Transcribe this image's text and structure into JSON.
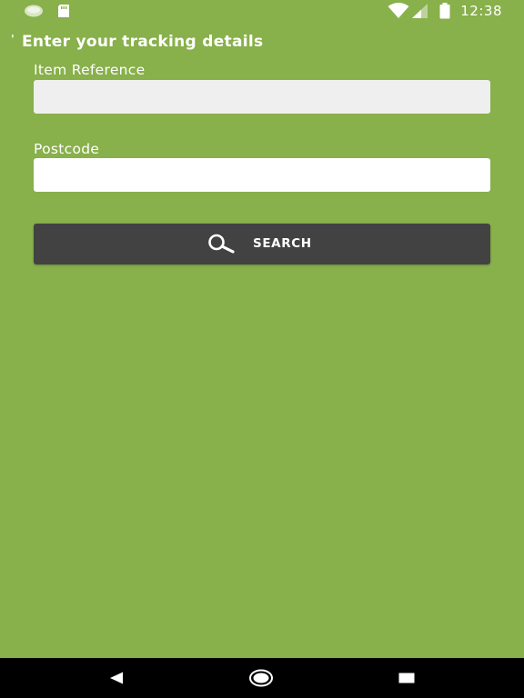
{
  "status_bar": {
    "time": "12:38",
    "icons": [
      "app-notification-icon",
      "sd-card-icon",
      "wifi-icon",
      "cell-signal-icon",
      "battery-icon"
    ]
  },
  "form": {
    "heading_mark": "'",
    "heading": "Enter your tracking details",
    "item_reference": {
      "label": "Item Reference",
      "value": "",
      "background": "#efefef"
    },
    "postcode": {
      "label": "Postcode",
      "value": "",
      "background": "#ffffff"
    },
    "search_button": {
      "label": "SEARCH",
      "background": "#424242"
    }
  },
  "nav_bar": {
    "buttons": [
      "back-icon",
      "home-icon",
      "recents-icon"
    ]
  },
  "colors": {
    "page_background": "#88b04b",
    "nav_background": "#000000",
    "text": "#ffffff"
  }
}
